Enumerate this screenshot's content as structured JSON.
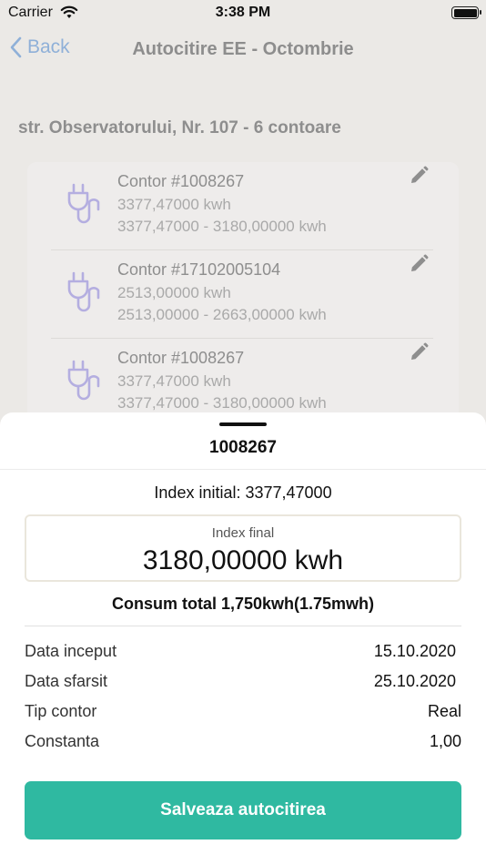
{
  "status_bar": {
    "carrier": "Carrier",
    "time": "3:38 PM"
  },
  "nav": {
    "back_label": "Back",
    "title": "Autocitire EE - Octombrie"
  },
  "address": "str. Observatorului, Nr. 107 - 6 contoare",
  "meters": [
    {
      "name": "Contor #1008267",
      "value": "3377,47000 kwh",
      "range": "3377,47000 - 3180,00000 kwh",
      "icon": "plug-icon"
    },
    {
      "name": "Contor #17102005104",
      "value": "2513,00000 kwh",
      "range": "2513,00000 - 2663,00000 kwh",
      "icon": "plug-icon"
    },
    {
      "name": "Contor #1008267",
      "value": "3377,47000 kwh",
      "range": "3377,47000 - 3180,00000 kwh",
      "icon": "plug-icon"
    }
  ],
  "sheet": {
    "title": "1008267",
    "index_initial": "Index initial: 3377,47000",
    "final_label": "Index final",
    "final_value": "3180,00000 kwh",
    "consum": "Consum total 1,750kwh(1.75mwh)",
    "details": [
      {
        "label": "Data inceput",
        "value": "15.10.2020"
      },
      {
        "label": "Data sfarsit",
        "value": "25.10.2020"
      },
      {
        "label": "Tip contor",
        "value": "Real"
      },
      {
        "label": "Constanta",
        "value": "1,00"
      }
    ],
    "save_label": "Salveaza autocitirea"
  },
  "colors": {
    "accent": "#2fb9a1",
    "back_link": "#8fb0d8",
    "plug_icon": "#b4aee0"
  }
}
